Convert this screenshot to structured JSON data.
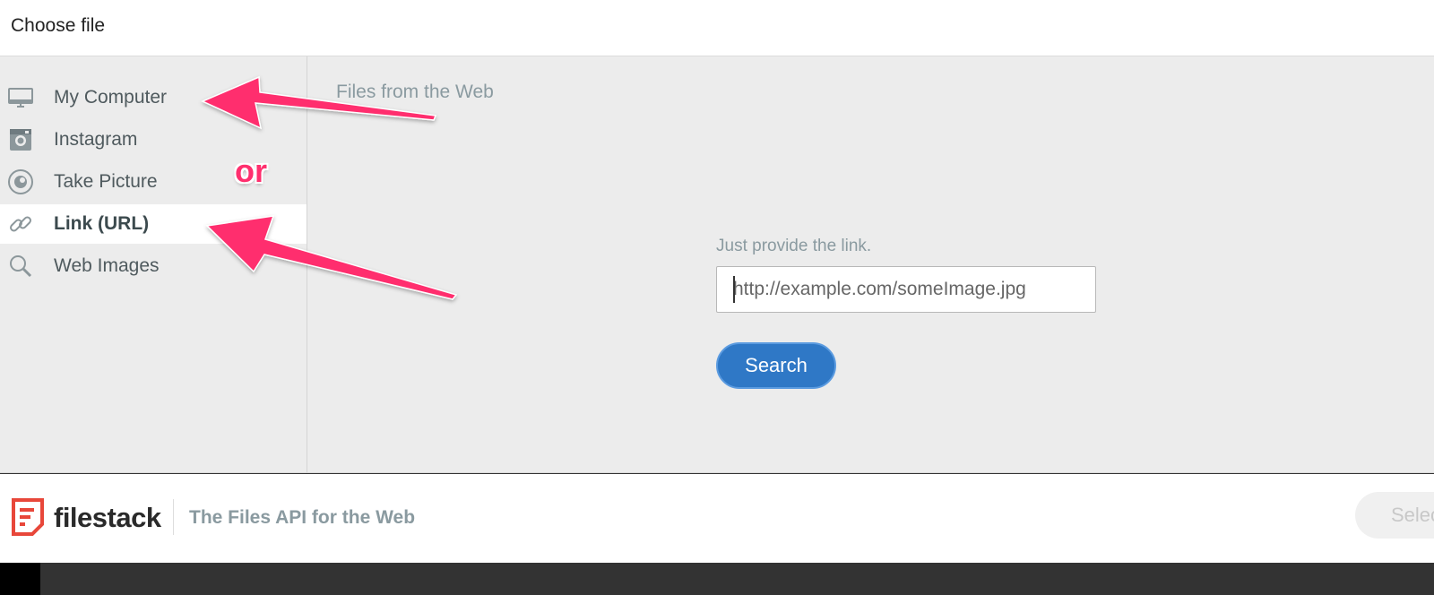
{
  "header": {
    "title": "Choose file"
  },
  "sidebar": {
    "items": [
      {
        "label": "My Computer",
        "icon": "monitor-icon"
      },
      {
        "label": "Instagram",
        "icon": "instagram-icon"
      },
      {
        "label": "Take Picture",
        "icon": "camera-icon"
      },
      {
        "label": "Link (URL)",
        "icon": "link-icon",
        "active": true
      },
      {
        "label": "Web Images",
        "icon": "search-icon"
      }
    ]
  },
  "main": {
    "title": "Files from the Web",
    "link_prompt": "Just provide the link.",
    "url_placeholder": "http://example.com/someImage.jpg",
    "search_label": "Search"
  },
  "footer": {
    "brand": "filestack",
    "tagline": "The Files API for the Web",
    "select_label": "Selec"
  },
  "annotation": {
    "or_text": "or",
    "color": "#ff2f6e"
  },
  "colors": {
    "accent": "#2f78c6",
    "brand_red": "#e8473a"
  }
}
